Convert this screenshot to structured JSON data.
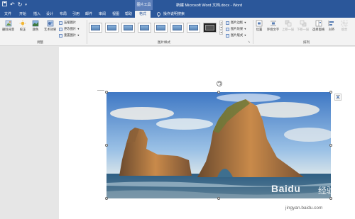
{
  "window": {
    "title": "新建 Microsoft Word 文档.docx - Word",
    "context_tab_group": "图片工具"
  },
  "tabs": [
    {
      "label": "文件"
    },
    {
      "label": "开始"
    },
    {
      "label": "插入"
    },
    {
      "label": "设计"
    },
    {
      "label": "布局"
    },
    {
      "label": "引用"
    },
    {
      "label": "邮件"
    },
    {
      "label": "审阅"
    },
    {
      "label": "视图"
    },
    {
      "label": "帮助"
    },
    {
      "label": "格式",
      "active": true
    }
  ],
  "tell_me": "操作说明搜索",
  "ribbon": {
    "adjust_group": {
      "label": "调整",
      "remove_bg": "删除背景",
      "corrections": "校正",
      "color": "颜色",
      "artistic": "艺术效果",
      "compress": "压缩图片",
      "change": "更改图片",
      "reset": "重置图片"
    },
    "styles_group": {
      "label": "图片样式",
      "border": "图片边框",
      "effects": "图片效果",
      "layout": "图片版式"
    },
    "arrange_group": {
      "label": "排列",
      "position": "位置",
      "wrap": "环绕文字",
      "bring_forward": "上移一层",
      "send_backward": "下移一层",
      "selection_pane": "选择窗格",
      "align": "对齐",
      "group": "组合"
    }
  },
  "watermark": {
    "brand": "Baidu",
    "brand_cn": "经验",
    "url": "jingyan.baidu.com"
  },
  "colors": {
    "title_bar": "#2b579a",
    "ribbon": "#f3f3f3",
    "page": "#ffffff",
    "workspace": "#e6e6e6"
  }
}
